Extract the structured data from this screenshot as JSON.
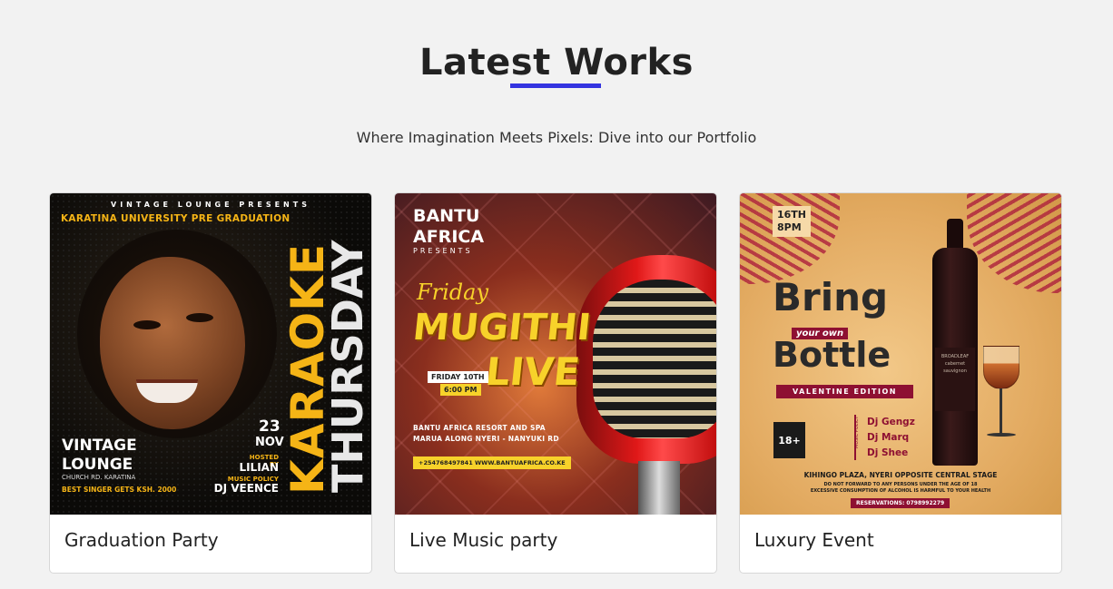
{
  "section": {
    "title": "Latest Works",
    "subtitle": "Where Imagination Meets Pixels: Dive into our Portfolio",
    "accent_color": "#3434e0"
  },
  "cards": [
    {
      "label": "Graduation Party",
      "poster": {
        "top_line": "VINTAGE LOUNGE PRESENTS",
        "event_line": "KARATINA UNIVERSITY PRE GRADUATION",
        "headline_1": "KARAOKE",
        "headline_2": "THURSDAY",
        "date_day": "23",
        "date_month": "NOV",
        "hosted_by_label": "HOSTED BY",
        "host": "LILIAN",
        "music_policy_label": "MUSIC POLICY",
        "dj": "DJ VEENCE",
        "venue_1": "VINTAGE",
        "venue_2": "LOUNGE",
        "address": "CHURCH RD. KARATINA",
        "prize": "BEST SINGER GETS KSH. 2000"
      }
    },
    {
      "label": "Live Music party",
      "poster": {
        "brand_1": "BANTU",
        "brand_2": "AFRICA",
        "presents": "PRESENTS",
        "script": "Friday",
        "headline_1": "MUGITHI",
        "headline_2": "LIVE",
        "day": "FRIDAY 10TH",
        "time": "6:00 PM",
        "venue_1": "BANTU AFRICA RESORT AND SPA",
        "venue_2": "MARUA  ALONG NYERI - NANYUKI RD",
        "contacts": "+254768497841   WWW.BANTUAFRICA.CO.KE"
      }
    },
    {
      "label": "Luxury Event",
      "poster": {
        "date_1": "16TH",
        "date_2": "8PM",
        "headline_1": "Bring",
        "tagline": "your own",
        "headline_2": "Bottle",
        "edition": "VALENTINE EDITION",
        "age": "18+",
        "music_policy_label": "MUSIC POLICY",
        "dj_1": "Dj Gengz",
        "dj_2": "Dj Marq",
        "dj_3": "Dj Shee",
        "venue": "KIHINGO PLAZA, NYERI OPPOSITE CENTRAL STAGE",
        "warning_1": "DO NOT FORWARD TO ANY PERSONS UNDER THE AGE OF 18",
        "warning_2": "EXCESSIVE CONSUMPTION OF ALCOHOL IS HARMFUL TO YOUR HEALTH",
        "reservations": "RESERVATIONS: 0798992279",
        "wine_brand": "BROADLEAF",
        "wine_type": "cabernet sauvignon"
      }
    }
  ]
}
